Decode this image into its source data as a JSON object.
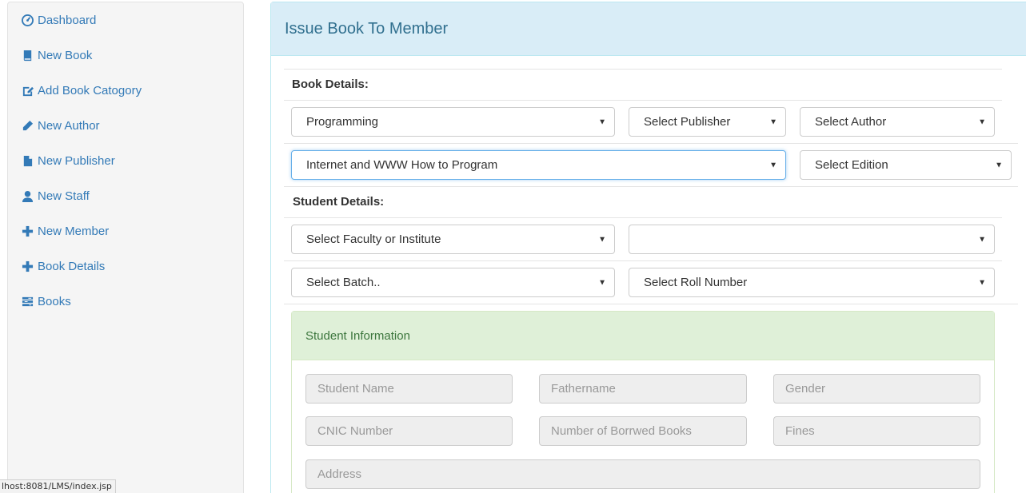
{
  "sidebar": {
    "items": [
      {
        "label": "Dashboard",
        "icon": "dashboard-icon"
      },
      {
        "label": "New Book",
        "icon": "book-icon"
      },
      {
        "label": "Add Book Catogory",
        "icon": "edit-icon"
      },
      {
        "label": "New Author",
        "icon": "pencil-icon"
      },
      {
        "label": "New Publisher",
        "icon": "file-icon"
      },
      {
        "label": "New Staff",
        "icon": "user-icon"
      },
      {
        "label": "New Member",
        "icon": "plus-icon"
      },
      {
        "label": "Book Details",
        "icon": "plus-icon"
      },
      {
        "label": "Books",
        "icon": "tasks-icon"
      }
    ]
  },
  "panel": {
    "title": "Issue Book To Member",
    "book_details_label": "Book Details:",
    "category_select": "Programming",
    "publisher_select": "Select Publisher",
    "author_select": "Select Author",
    "book_select": "Internet and WWW How to Program",
    "edition_select": "Select Edition",
    "student_details_label": "Student Details:",
    "faculty_select": "Select Faculty or Institute",
    "department_select": "",
    "batch_select": "Select Batch..",
    "roll_select": "Select Roll Number"
  },
  "student_info": {
    "title": "Student Information",
    "fields": {
      "name": "Student Name",
      "fathername": "Fathername",
      "gender": "Gender",
      "cnic": "CNIC Number",
      "borrowed": "Number of Borrwed Books",
      "fines": "Fines",
      "address": "Address"
    }
  },
  "statusbar": {
    "url": "lhost:8081/LMS/index.jsp"
  },
  "colors": {
    "link": "#337ab7",
    "info_heading_bg": "#d9edf7",
    "success_heading_bg": "#dff0d8"
  }
}
